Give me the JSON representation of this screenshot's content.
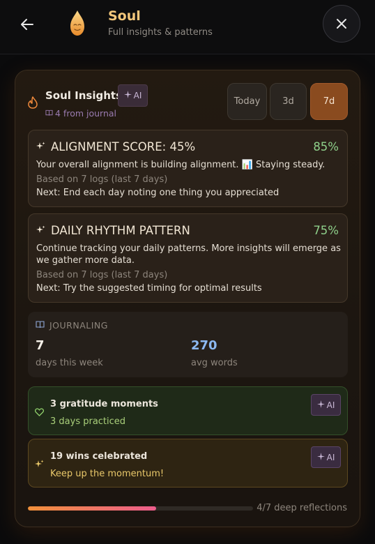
{
  "header": {
    "title": "Soul",
    "subtitle": "Full insights & patterns",
    "back_icon": "arrow-left-icon",
    "close_icon": "close-icon"
  },
  "panel": {
    "title": "Soul Insights",
    "ai_badge": "AI",
    "source_text": "4 from journal",
    "ranges": [
      "Today",
      "3d",
      "7d"
    ],
    "selected_range": "7d"
  },
  "insights": [
    {
      "title": "ALIGNMENT SCORE: 45%",
      "percent": "85%",
      "body": "Your overall alignment is building alignment. 📊 Staying steady.",
      "meta": "Based on 7 logs (last 7 days)",
      "next": "Next: End each day noting one thing you appreciated"
    },
    {
      "title": "DAILY RHYTHM PATTERN",
      "percent": "75%",
      "body": "Continue tracking your daily patterns. More insights will emerge as we gather more data.",
      "meta": "Based on 7 logs (last 7 days)",
      "next": "Next: Try the suggested timing for optimal results"
    }
  ],
  "journaling": {
    "label": "JOURNALING",
    "days_value": "7",
    "days_label": "days this week",
    "words_value": "270",
    "words_label": "avg words"
  },
  "gratitude": {
    "title": "3 gratitude moments",
    "subtitle": "3 days practiced",
    "ai_badge": "AI"
  },
  "wins": {
    "title": "19 wins celebrated",
    "subtitle": "Keep up the momentum!",
    "ai_badge": "AI"
  },
  "progress": {
    "text": "4/7 deep reflections",
    "fraction": 0.571
  },
  "colors": {
    "accent_gold": "#f3c77b",
    "percent_green": "#8fd18b",
    "selected_range_bg": "#8a4b1f",
    "words_blue": "#8cb8f0"
  }
}
